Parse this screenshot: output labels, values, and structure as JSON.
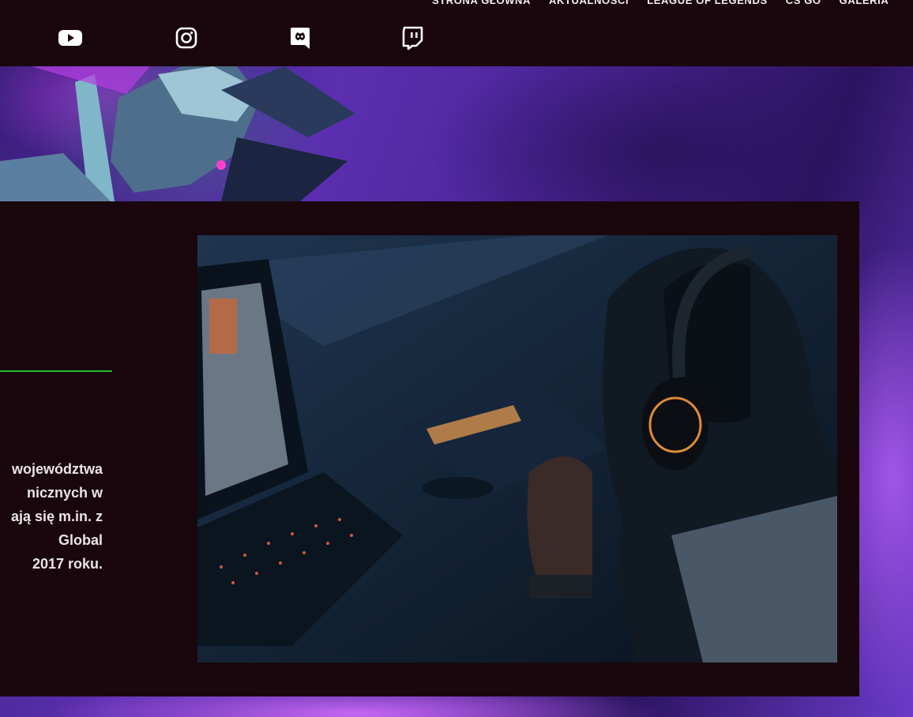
{
  "nav": {
    "items": [
      "STRONA GŁÓWNA",
      "AKTUALNOŚCI",
      "LEAGUE OF LEGENDS",
      "CS GO",
      "GALERIA"
    ]
  },
  "social": [
    "youtube-icon",
    "instagram-icon",
    "discord-icon",
    "twitch-icon"
  ],
  "about": {
    "text": "województwa\nnicznych w\nają się m.in. z\nGlobal\n2017 roku."
  },
  "colors": {
    "background": "#1a070d",
    "divider": "#1fbf2a",
    "text": "#e9e4e6"
  }
}
